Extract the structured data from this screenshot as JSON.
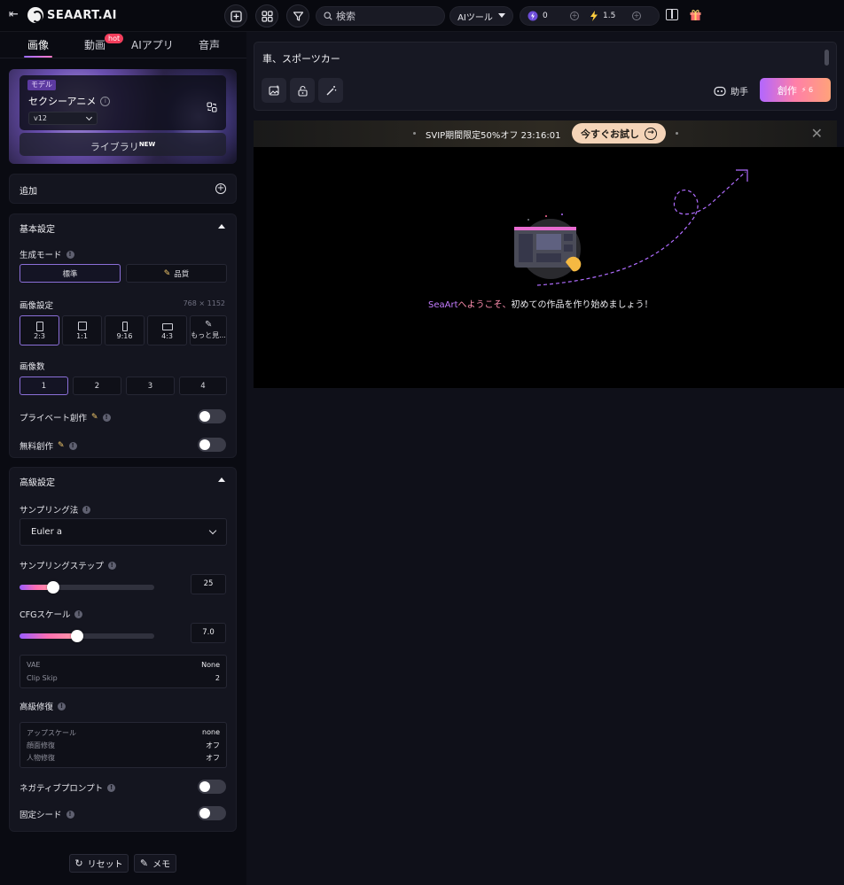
{
  "topbar": {
    "brand": "SEAART.AI",
    "search_placeholder": "検索",
    "aitool_label": "AIツール",
    "credit_a": "0",
    "credit_b": "1.5"
  },
  "tabs": [
    {
      "label": "画像"
    },
    {
      "label": "動画"
    },
    {
      "label": "AIアプリ"
    },
    {
      "label": "音声"
    }
  ],
  "tab_badge": "hot",
  "model": {
    "tag": "モデル",
    "name": "セクシーアニメ",
    "version": "v12",
    "library_label": "ライブラリ",
    "library_badge": "NEW"
  },
  "add_label": "追加",
  "basic": {
    "title": "基本設定",
    "mode_label": "生成モード",
    "modes": [
      "標準",
      "品質"
    ],
    "image_setting_label": "画像設定",
    "resolution": "768 × 1152",
    "ratios": [
      "2:3",
      "1:1",
      "9:16",
      "4:3",
      "もっと見..."
    ],
    "count_label": "画像数",
    "counts": [
      "1",
      "2",
      "3",
      "4"
    ],
    "private_label": "プライベート創作",
    "free_label": "無料創作"
  },
  "advanced": {
    "title": "高級設定",
    "sampler_label": "サンプリング法",
    "sampler_value": "Euler a",
    "steps_label": "サンプリングステップ",
    "steps_value": "25",
    "steps_fraction": 0.25,
    "cfg_label": "CFGスケール",
    "cfg_value": "7.0",
    "cfg_fraction": 0.43,
    "vae_key": "VAE",
    "vae_value": "None",
    "clip_key": "Clip Skip",
    "clip_value": "2",
    "fix_label": "高級修復",
    "upscale_key": "アップスケール",
    "upscale_value": "none",
    "face_key": "顔面修復",
    "face_value": "オフ",
    "person_key": "人物修復",
    "person_value": "オフ",
    "negative_label": "ネガティブプロンプト",
    "seed_label": "固定シード"
  },
  "bottom": {
    "reset_label": "リセット",
    "memo_label": "メモ"
  },
  "prompt": {
    "text": "車、スポーツカー",
    "assist_label": "助手",
    "create_label": "創作",
    "create_cost": "6"
  },
  "promo": {
    "text": "SVIP期間限定50%オフ 23:16:01",
    "button": "今すぐお試し"
  },
  "welcome": {
    "brand": "SeaArt",
    "accent": "へようこそ、",
    "rest": "初めての作品を作り始めましょう！"
  },
  "colors": {
    "accent_purple": "#9b6cff",
    "accent_pink": "#ff7ac6",
    "promo_button": "#f4d4b8"
  }
}
